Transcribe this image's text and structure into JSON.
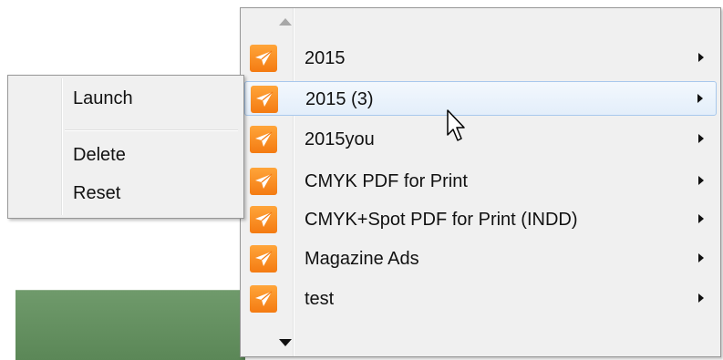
{
  "main_menu": {
    "items": [
      {
        "label": "2015",
        "icon": "send-icon",
        "has_submenu": true
      },
      {
        "label": "2015 (3)",
        "icon": "send-icon",
        "has_submenu": true,
        "hover": true
      },
      {
        "label": "2015you",
        "icon": "send-icon",
        "has_submenu": true
      },
      {
        "label": "CMYK PDF for Print",
        "icon": "send-icon",
        "has_submenu": true
      },
      {
        "label": "CMYK+Spot PDF for Print (INDD)",
        "icon": "send-icon",
        "has_submenu": true
      },
      {
        "label": "Magazine Ads",
        "icon": "send-icon",
        "has_submenu": true
      },
      {
        "label": "test",
        "icon": "send-icon",
        "has_submenu": true
      }
    ]
  },
  "context_menu": {
    "launch": "Launch",
    "delete": "Delete",
    "reset": "Reset"
  },
  "colors": {
    "icon_top": "#ffa53a",
    "icon_bottom": "#f47b12",
    "hover_border": "#a8c8ec",
    "menu_bg": "#f0f0f0"
  }
}
